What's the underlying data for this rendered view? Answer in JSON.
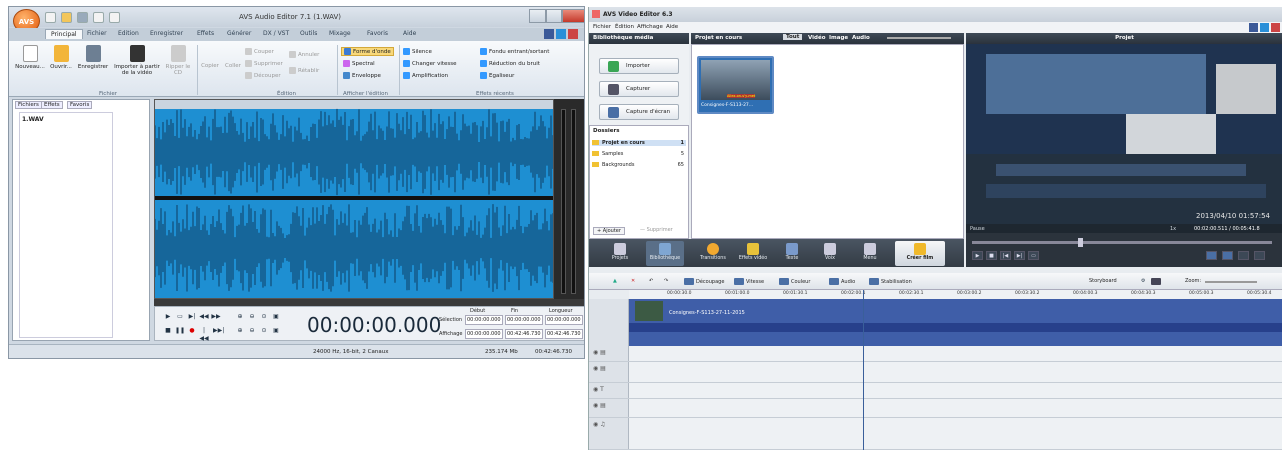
{
  "audio": {
    "logo": "AVS",
    "title": "AVS Audio Editor 7.1 (1.WAV)",
    "tabs": [
      "Principal",
      "Fichier",
      "Edition",
      "Enregistrer",
      "Effets",
      "Générer",
      "DX / VST",
      "Outils",
      "Mixage",
      "Favoris",
      "Aide"
    ],
    "file_buttons": [
      "Nouveau...",
      "Ouvrir...",
      "Enregistrer",
      "Importer à partir de la vidéo",
      "Ripper le CD"
    ],
    "edit_buttons": [
      "Copier",
      "Coller",
      "Couper",
      "Supprimer",
      "Découper",
      "Annuler",
      "Rétablir"
    ],
    "view_buttons": [
      "Forme d'onde",
      "Spectral",
      "Enveloppe"
    ],
    "effect_buttons": [
      "Silence",
      "Changer vitesse",
      "Amplification",
      "Fondu entrant/sortant",
      "Réduction du bruit",
      "Egaliseur"
    ],
    "groups": [
      "Fichier",
      "Édition",
      "Afficher l'édition",
      "Effets récents"
    ],
    "side_tabs": [
      "Fichiers",
      "Effets",
      "Favoris"
    ],
    "file_item": "1.WAV",
    "time": "00:00:00.000",
    "sel_headers": [
      "Début",
      "Fin",
      "Longueur"
    ],
    "selection_label": "Sélection",
    "selection_vals": [
      "00:00:00.000",
      "00:00:00.000",
      "00:00:00.000"
    ],
    "display_label": "Affichage",
    "display_vals": [
      "00:00:00.000",
      "00:42:46.730",
      "00:42:46.730"
    ],
    "status_format": "24000 Hz, 16-bit, 2 Canaux",
    "status_size": "235.174 Mb",
    "status_duration": "00:42:46.730"
  },
  "video": {
    "title": "AVS Video Editor 6.3",
    "menu": [
      "Fichier",
      "Édition",
      "Affichage",
      "Aide"
    ],
    "lib_title": "Bibliothèque média",
    "project_current": "Projet en cours",
    "filter_tabs": [
      "Tout",
      "Vidéo",
      "Image",
      "Audio"
    ],
    "preview_title": "Projet",
    "lib_buttons": [
      "Importer",
      "Capturer",
      "Capture d'écran"
    ],
    "folders_title": "Dossiers",
    "folders": [
      {
        "name": "Projet en cours",
        "count": "1"
      },
      {
        "name": "Samples",
        "count": "5"
      },
      {
        "name": "Backgrounds",
        "count": "65"
      }
    ],
    "add_label": "+ Ajouter",
    "remove_label": "— Supprimer",
    "thumb_caption": "Consignes-F-S113-27...",
    "thumb_overlay": "Allez-on-s'y-met",
    "preview_timestamp": "2013/04/10 01:57:54",
    "status": "Pause",
    "speed": "1x",
    "time": "00:02:00.511 / 00:05:41.8",
    "tools": [
      "Projets",
      "Bibliothèque",
      "Transitions",
      "Effets vidéo",
      "Texte",
      "Voix",
      "Menu",
      "Créer film"
    ],
    "tl_buttons": [
      "Découpage",
      "Vitesse",
      "Couleur",
      "Audio",
      "Stabilisation"
    ],
    "storyboard": "Storyboard",
    "zoom": "Zoom:",
    "ruler": [
      "00:00:30.0",
      "00:01:00.0",
      "00:01:30.1",
      "00:02:00.1",
      "00:02:30.1",
      "00:03:00.2",
      "00:03:30.2",
      "00:04:00.3",
      "00:04:30.3",
      "00:05:00.3",
      "00:05:30.4"
    ],
    "clip_label": "Consignes-F-S113-27-11-2015"
  }
}
